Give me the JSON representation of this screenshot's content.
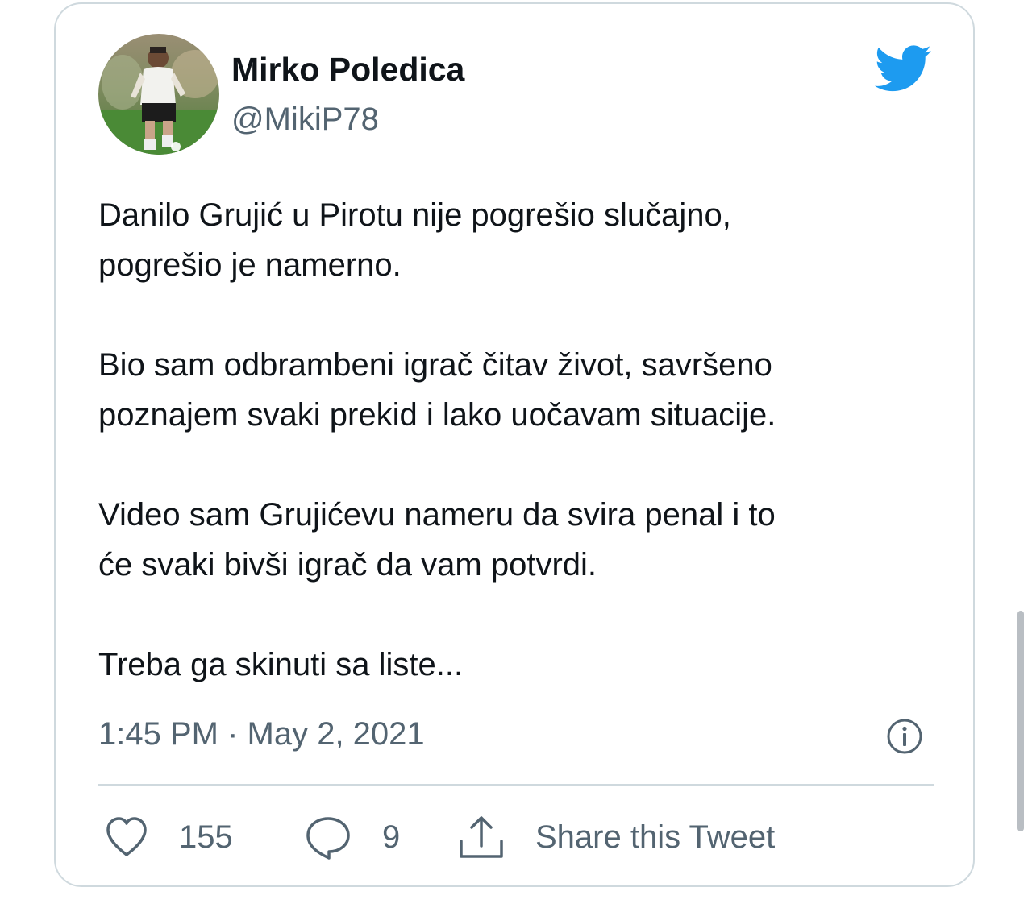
{
  "tweet": {
    "author": {
      "display_name": "Mirko Poledica",
      "handle": "@MikiP78",
      "avatar_icon": "profile-photo-footballer"
    },
    "paragraphs": [
      "Danilo Grujić u Pirotu nije pogrešio slučajno,\npogrešio je namerno.",
      "Bio sam odbrambeni igrač čitav život, savršeno\npoznajem svaki prekid i lako uočavam situacije.",
      "Video sam Grujićevu nameru da svira penal i to\nće svaki bivši igrač da vam potvrdi.",
      "Treba ga skinuti sa liste..."
    ],
    "timestamp": "1:45 PM · May 2, 2021"
  },
  "actions": {
    "like_count": "155",
    "reply_count": "9",
    "share_label": "Share this Tweet"
  },
  "icons": {
    "brand": "twitter-bird-icon",
    "info": "info-icon",
    "like": "heart-icon",
    "reply": "speech-bubble-icon",
    "share": "share-upload-icon"
  },
  "colors": {
    "twitter_blue": "#1d9bf0",
    "text_primary": "#0f1419",
    "text_secondary": "#536471",
    "border": "#cfd9de"
  }
}
